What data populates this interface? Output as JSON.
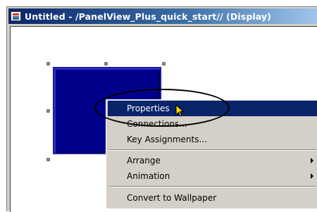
{
  "window": {
    "title": "Untitled - /PanelView_Plus_quick_start// (Display)"
  },
  "context_menu": {
    "items": [
      {
        "label": "Properties",
        "selected": true
      },
      {
        "label": "Connections..."
      },
      {
        "label": "Key Assignments..."
      },
      {
        "label": "Arrange",
        "submenu": true
      },
      {
        "label": "Animation",
        "submenu": true
      },
      {
        "label": "Convert to Wallpaper"
      }
    ]
  },
  "colors": {
    "object_fill": "#00008b",
    "menu_highlight": "#0a246a",
    "title_bar": "#0a246a"
  }
}
